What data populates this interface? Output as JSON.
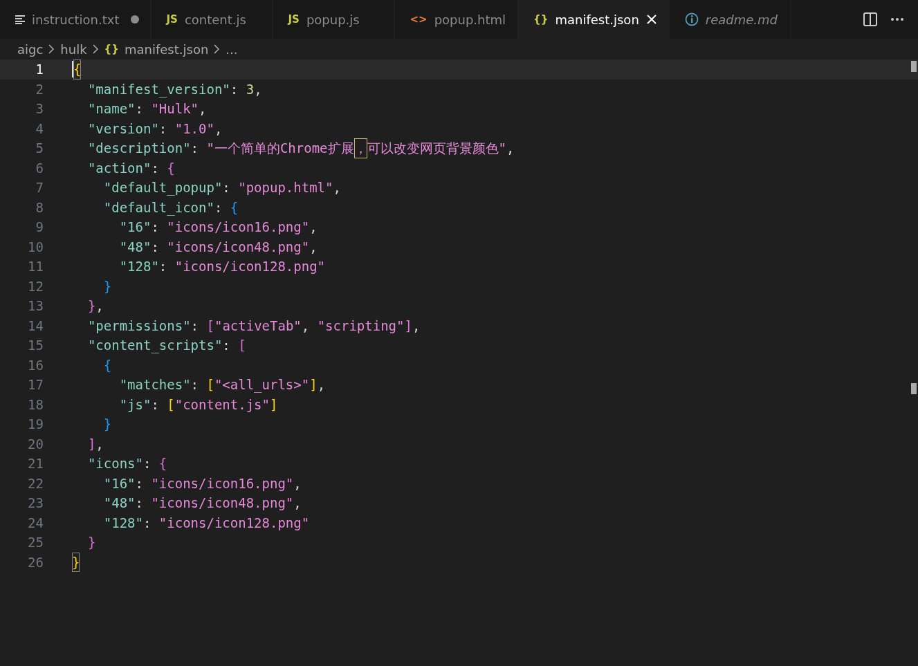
{
  "tabs": [
    {
      "label": "instruction.txt",
      "kind": "lines",
      "selected": false,
      "dirty": true,
      "preview": false
    },
    {
      "label": "content.js",
      "kind": "js",
      "icon_text": "JS",
      "selected": false,
      "dirty": false,
      "preview": false
    },
    {
      "label": "popup.js",
      "kind": "js",
      "icon_text": "JS",
      "selected": false,
      "dirty": false,
      "preview": false
    },
    {
      "label": "popup.html",
      "kind": "html",
      "icon_text": "<>",
      "selected": false,
      "dirty": false,
      "preview": false
    },
    {
      "label": "manifest.json",
      "kind": "json",
      "icon_text": "{}",
      "selected": true,
      "dirty": false,
      "preview": false
    },
    {
      "label": "readme.md",
      "kind": "info",
      "selected": false,
      "dirty": false,
      "preview": true
    }
  ],
  "breadcrumb": [
    {
      "label": "aigc"
    },
    {
      "label": "hulk"
    },
    {
      "label": "manifest.json",
      "icon_text": "{}"
    },
    {
      "label": "..."
    }
  ],
  "editor": {
    "lines": [
      {
        "number": "1",
        "current": true,
        "tokens": [
          {
            "kind": "bracket",
            "text": "{",
            "color": "#ffd700",
            "matched": true
          }
        ]
      },
      {
        "number": "2",
        "current": false,
        "tokens": [
          {
            "kind": "key",
            "text": "\"manifest_version\""
          },
          {
            "kind": "punct",
            "text": ": "
          },
          {
            "kind": "number",
            "text": "3"
          },
          {
            "kind": "punct",
            "text": ","
          }
        ]
      },
      {
        "number": "3",
        "current": false,
        "tokens": [
          {
            "kind": "key",
            "text": "\"name\""
          },
          {
            "kind": "punct",
            "text": ": "
          },
          {
            "kind": "string",
            "text": "\"Hulk\""
          },
          {
            "kind": "punct",
            "text": ","
          }
        ]
      },
      {
        "number": "4",
        "current": false,
        "tokens": [
          {
            "kind": "key",
            "text": "\"version\""
          },
          {
            "kind": "punct",
            "text": ": "
          },
          {
            "kind": "string",
            "text": "\"1.0\""
          },
          {
            "kind": "punct",
            "text": ","
          }
        ]
      },
      {
        "number": "5",
        "current": false,
        "tokens": [
          {
            "kind": "key",
            "text": "\"description\""
          },
          {
            "kind": "punct",
            "text": ": "
          },
          {
            "kind": "string",
            "text": "\"一个简单的Chrome扩展"
          },
          {
            "kind": "string",
            "text": "，",
            "highlighted": true
          },
          {
            "kind": "string",
            "text": "可以改变网页背景颜色\""
          },
          {
            "kind": "punct",
            "text": ","
          }
        ]
      },
      {
        "number": "6",
        "current": false,
        "tokens": [
          {
            "kind": "key",
            "text": "\"action\""
          },
          {
            "kind": "punct",
            "text": ": "
          },
          {
            "kind": "bracket",
            "text": "{",
            "color": "#da70d6"
          }
        ]
      },
      {
        "number": "7",
        "current": false,
        "tokens": [
          {
            "kind": "key",
            "text": "\"default_popup\""
          },
          {
            "kind": "punct",
            "text": ": "
          },
          {
            "kind": "string",
            "text": "\"popup.html\""
          },
          {
            "kind": "punct",
            "text": ","
          }
        ]
      },
      {
        "number": "8",
        "current": false,
        "tokens": [
          {
            "kind": "key",
            "text": "\"default_icon\""
          },
          {
            "kind": "punct",
            "text": ": "
          },
          {
            "kind": "bracket",
            "text": "{",
            "color": "#179fff"
          }
        ]
      },
      {
        "number": "9",
        "current": false,
        "tokens": [
          {
            "kind": "key",
            "text": "\"16\""
          },
          {
            "kind": "punct",
            "text": ": "
          },
          {
            "kind": "string",
            "text": "\"icons/icon16.png\""
          },
          {
            "kind": "punct",
            "text": ","
          }
        ]
      },
      {
        "number": "10",
        "current": false,
        "tokens": [
          {
            "kind": "key",
            "text": "\"48\""
          },
          {
            "kind": "punct",
            "text": ": "
          },
          {
            "kind": "string",
            "text": "\"icons/icon48.png\""
          },
          {
            "kind": "punct",
            "text": ","
          }
        ]
      },
      {
        "number": "11",
        "current": false,
        "tokens": [
          {
            "kind": "key",
            "text": "\"128\""
          },
          {
            "kind": "punct",
            "text": ": "
          },
          {
            "kind": "string",
            "text": "\"icons/icon128.png\""
          }
        ]
      },
      {
        "number": "12",
        "current": false,
        "tokens": [
          {
            "kind": "bracket",
            "text": "}",
            "color": "#179fff"
          }
        ]
      },
      {
        "number": "13",
        "current": false,
        "tokens": [
          {
            "kind": "bracket",
            "text": "}",
            "color": "#da70d6"
          },
          {
            "kind": "punct",
            "text": ","
          }
        ]
      },
      {
        "number": "14",
        "current": false,
        "tokens": [
          {
            "kind": "key",
            "text": "\"permissions\""
          },
          {
            "kind": "punct",
            "text": ": "
          },
          {
            "kind": "bracket",
            "text": "[",
            "color": "#da70d6"
          },
          {
            "kind": "string",
            "text": "\"activeTab\""
          },
          {
            "kind": "punct",
            "text": ", "
          },
          {
            "kind": "string",
            "text": "\"scripting\""
          },
          {
            "kind": "bracket",
            "text": "]",
            "color": "#da70d6"
          },
          {
            "kind": "punct",
            "text": ","
          }
        ]
      },
      {
        "number": "15",
        "current": false,
        "tokens": [
          {
            "kind": "key",
            "text": "\"content_scripts\""
          },
          {
            "kind": "punct",
            "text": ": "
          },
          {
            "kind": "bracket",
            "text": "[",
            "color": "#da70d6"
          }
        ]
      },
      {
        "number": "16",
        "current": false,
        "tokens": [
          {
            "kind": "bracket",
            "text": "{",
            "color": "#179fff"
          }
        ]
      },
      {
        "number": "17",
        "current": false,
        "tokens": [
          {
            "kind": "key",
            "text": "\"matches\""
          },
          {
            "kind": "punct",
            "text": ": "
          },
          {
            "kind": "bracket",
            "text": "[",
            "color": "#ffd700"
          },
          {
            "kind": "string",
            "text": "\"<all_urls>\""
          },
          {
            "kind": "bracket",
            "text": "]",
            "color": "#ffd700"
          },
          {
            "kind": "punct",
            "text": ","
          }
        ]
      },
      {
        "number": "18",
        "current": false,
        "tokens": [
          {
            "kind": "key",
            "text": "\"js\""
          },
          {
            "kind": "punct",
            "text": ": "
          },
          {
            "kind": "bracket",
            "text": "[",
            "color": "#ffd700"
          },
          {
            "kind": "string",
            "text": "\"content.js\""
          },
          {
            "kind": "bracket",
            "text": "]",
            "color": "#ffd700"
          }
        ]
      },
      {
        "number": "19",
        "current": false,
        "tokens": [
          {
            "kind": "bracket",
            "text": "}",
            "color": "#179fff"
          }
        ]
      },
      {
        "number": "20",
        "current": false,
        "tokens": [
          {
            "kind": "bracket",
            "text": "]",
            "color": "#da70d6"
          },
          {
            "kind": "punct",
            "text": ","
          }
        ]
      },
      {
        "number": "21",
        "current": false,
        "tokens": [
          {
            "kind": "key",
            "text": "\"icons\""
          },
          {
            "kind": "punct",
            "text": ": "
          },
          {
            "kind": "bracket",
            "text": "{",
            "color": "#da70d6"
          }
        ]
      },
      {
        "number": "22",
        "current": false,
        "tokens": [
          {
            "kind": "key",
            "text": "\"16\""
          },
          {
            "kind": "punct",
            "text": ": "
          },
          {
            "kind": "string",
            "text": "\"icons/icon16.png\""
          },
          {
            "kind": "punct",
            "text": ","
          }
        ]
      },
      {
        "number": "23",
        "current": false,
        "tokens": [
          {
            "kind": "key",
            "text": "\"48\""
          },
          {
            "kind": "punct",
            "text": ": "
          },
          {
            "kind": "string",
            "text": "\"icons/icon48.png\""
          },
          {
            "kind": "punct",
            "text": ","
          }
        ]
      },
      {
        "number": "24",
        "current": false,
        "tokens": [
          {
            "kind": "key",
            "text": "\"128\""
          },
          {
            "kind": "punct",
            "text": ": "
          },
          {
            "kind": "string",
            "text": "\"icons/icon128.png\""
          }
        ]
      },
      {
        "number": "25",
        "current": false,
        "tokens": [
          {
            "kind": "bracket",
            "text": "}",
            "color": "#da70d6"
          }
        ]
      },
      {
        "number": "26",
        "current": false,
        "tokens": [
          {
            "kind": "bracket",
            "text": "}",
            "color": "#ffd700",
            "matched": true
          }
        ]
      }
    ]
  }
}
